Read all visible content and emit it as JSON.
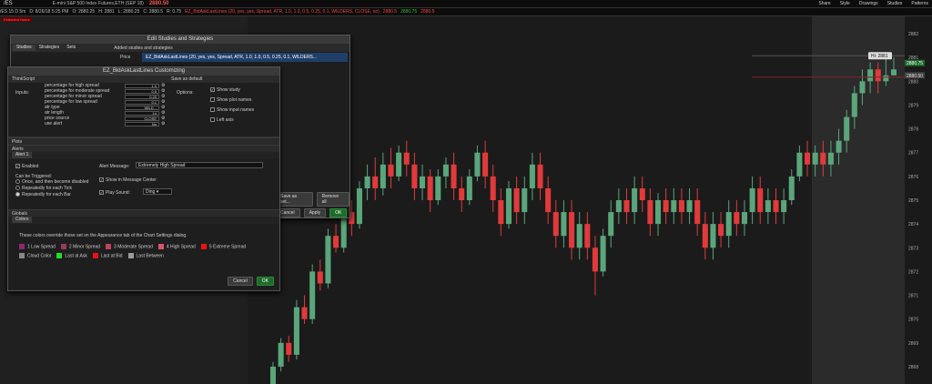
{
  "topbar": {
    "symbol": "/ES",
    "description": "E-mini S&P 500 Index Futures,ETH (SEP 18)",
    "price": "2880.50",
    "tools": [
      "Share",
      "Style",
      "Drawings",
      "Studies",
      "Patterns"
    ]
  },
  "infobar": {
    "symbol": "/ES 15 D 5m",
    "date": "D: 8/26/18 5:25 PM",
    "open": "O: 2880.25",
    "high": "H: 2881",
    "low": "L: 2880.25",
    "close": "C: 2880.5",
    "range": "R: 0.75",
    "study": "EZ_BidAskLastLines (20, yes, yes, Spread, ATR, 1.0, 1.0, 0.5, 0.25, 0.1, WILDERS, CLOSE, no)",
    "v1": "2880.5",
    "v2": "2880.75",
    "v3": "2880.5"
  },
  "badge": "Extended Hours",
  "chart_data": {
    "type": "candlestick",
    "ylim": [
      2867.5,
      2882.5
    ],
    "yticks": [
      "2882",
      "2881",
      "2880",
      "2879",
      "2878",
      "2877",
      "2876",
      "2875",
      "2874",
      "2873",
      "2872",
      "2871",
      "2870",
      "2869",
      "2868"
    ],
    "hi_label": "Hi: 2881",
    "price_labels": [
      "2880.75",
      "2880.50"
    ],
    "candles": [
      [
        2867.0,
        2868.0,
        2866.8,
        2868.2
      ],
      [
        2868.0,
        2869.0,
        2867.8,
        2869.2
      ],
      [
        2869.0,
        2868.5,
        2868.2,
        2869.3
      ],
      [
        2868.5,
        2870.5,
        2868.3,
        2870.8
      ],
      [
        2870.5,
        2870.0,
        2869.8,
        2871.0
      ],
      [
        2870.0,
        2872.0,
        2869.8,
        2872.3
      ],
      [
        2872.0,
        2871.5,
        2871.2,
        2872.5
      ],
      [
        2871.5,
        2873.5,
        2871.3,
        2873.8
      ],
      [
        2873.5,
        2873.0,
        2872.8,
        2874.0
      ],
      [
        2873.0,
        2874.5,
        2872.8,
        2874.8
      ],
      [
        2874.5,
        2874.0,
        2873.5,
        2875.0
      ],
      [
        2874.0,
        2875.5,
        2873.8,
        2875.8
      ],
      [
        2875.5,
        2876.0,
        2875.0,
        2876.5
      ],
      [
        2876.0,
        2875.5,
        2875.0,
        2876.8
      ],
      [
        2875.5,
        2876.5,
        2875.2,
        2877.0
      ],
      [
        2876.5,
        2876.0,
        2875.5,
        2877.2
      ],
      [
        2876.0,
        2877.0,
        2875.8,
        2877.3
      ],
      [
        2877.0,
        2876.5,
        2876.0,
        2877.5
      ],
      [
        2876.5,
        2875.5,
        2875.0,
        2877.0
      ],
      [
        2875.5,
        2876.0,
        2875.0,
        2876.5
      ],
      [
        2876.0,
        2875.0,
        2874.5,
        2876.3
      ],
      [
        2875.0,
        2876.0,
        2874.8,
        2876.3
      ],
      [
        2876.0,
        2876.5,
        2875.5,
        2876.8
      ],
      [
        2876.5,
        2875.5,
        2875.0,
        2877.0
      ],
      [
        2875.5,
        2875.0,
        2874.5,
        2876.0
      ],
      [
        2875.0,
        2876.0,
        2874.8,
        2876.3
      ],
      [
        2876.0,
        2877.0,
        2875.8,
        2877.3
      ],
      [
        2877.0,
        2876.0,
        2875.5,
        2877.5
      ],
      [
        2876.0,
        2875.0,
        2874.5,
        2876.5
      ],
      [
        2875.0,
        2874.0,
        2873.5,
        2875.5
      ],
      [
        2874.0,
        2875.5,
        2873.8,
        2875.8
      ],
      [
        2875.5,
        2874.5,
        2874.0,
        2876.0
      ],
      [
        2874.5,
        2875.5,
        2874.0,
        2876.0
      ],
      [
        2875.5,
        2876.5,
        2875.0,
        2877.0
      ],
      [
        2876.5,
        2875.5,
        2875.0,
        2877.0
      ],
      [
        2875.5,
        2874.5,
        2874.0,
        2876.0
      ],
      [
        2874.5,
        2873.5,
        2873.0,
        2875.0
      ],
      [
        2873.5,
        2874.5,
        2873.0,
        2875.0
      ],
      [
        2874.5,
        2873.0,
        2872.5,
        2875.0
      ],
      [
        2873.0,
        2874.0,
        2872.5,
        2874.5
      ],
      [
        2874.0,
        2873.0,
        2872.5,
        2874.5
      ],
      [
        2873.0,
        2872.0,
        2871.0,
        2873.5
      ],
      [
        2872.0,
        2873.5,
        2871.8,
        2873.8
      ],
      [
        2873.5,
        2874.5,
        2873.0,
        2875.0
      ],
      [
        2874.5,
        2875.0,
        2874.0,
        2875.5
      ],
      [
        2875.0,
        2874.5,
        2874.0,
        2875.5
      ],
      [
        2874.5,
        2875.5,
        2874.0,
        2876.0
      ],
      [
        2875.5,
        2875.0,
        2874.5,
        2876.0
      ],
      [
        2875.0,
        2874.0,
        2873.5,
        2875.5
      ],
      [
        2874.0,
        2875.0,
        2873.5,
        2875.3
      ],
      [
        2875.0,
        2874.5,
        2874.0,
        2875.5
      ],
      [
        2874.5,
        2875.0,
        2874.0,
        2875.5
      ],
      [
        2875.0,
        2874.5,
        2874.0,
        2875.5
      ],
      [
        2874.5,
        2875.0,
        2874.0,
        2875.5
      ],
      [
        2875.0,
        2874.0,
        2873.5,
        2875.5
      ],
      [
        2874.0,
        2873.0,
        2872.5,
        2874.5
      ],
      [
        2873.0,
        2874.0,
        2872.5,
        2874.5
      ],
      [
        2874.0,
        2873.5,
        2873.0,
        2874.5
      ],
      [
        2873.5,
        2874.5,
        2873.0,
        2875.0
      ],
      [
        2874.5,
        2874.0,
        2873.5,
        2875.0
      ],
      [
        2874.0,
        2874.5,
        2873.5,
        2875.0
      ],
      [
        2874.5,
        2875.5,
        2874.0,
        2876.0
      ],
      [
        2875.5,
        2874.5,
        2874.0,
        2876.0
      ],
      [
        2874.5,
        2875.0,
        2874.0,
        2875.5
      ],
      [
        2875.0,
        2874.5,
        2874.0,
        2875.5
      ],
      [
        2874.5,
        2875.0,
        2874.0,
        2875.5
      ],
      [
        2875.0,
        2876.0,
        2874.8,
        2876.3
      ],
      [
        2876.0,
        2877.0,
        2875.8,
        2877.3
      ],
      [
        2877.0,
        2876.5,
        2876.0,
        2877.5
      ],
      [
        2876.5,
        2877.0,
        2876.0,
        2877.3
      ],
      [
        2877.0,
        2876.5,
        2876.0,
        2877.5
      ],
      [
        2876.5,
        2877.0,
        2876.0,
        2877.5
      ],
      [
        2877.0,
        2877.5,
        2876.5,
        2878.0
      ],
      [
        2877.5,
        2878.5,
        2877.0,
        2878.8
      ],
      [
        2878.5,
        2879.5,
        2878.0,
        2879.8
      ],
      [
        2879.5,
        2880.0,
        2879.0,
        2880.5
      ],
      [
        2880.0,
        2880.5,
        2879.5,
        2880.8
      ],
      [
        2880.5,
        2880.0,
        2879.5,
        2880.8
      ],
      [
        2880.0,
        2880.25,
        2879.8,
        2881.0
      ],
      [
        2880.25,
        2880.5,
        2880.25,
        2881.0
      ]
    ]
  },
  "studies_dlg": {
    "title": "Edit Studies and Strategies",
    "tabs": [
      "Studies",
      "Strategies",
      "Sets"
    ],
    "added_label": "Added studies and strategies",
    "price_label": "Price",
    "study_entry": "EZ_BidAskLastLines (20, yes, yes, Spread, ATR, 1.0, 1.0, 0.5, 0.25, 0.1, WILDERS...",
    "save_as_set": "Save as set...",
    "remove_all": "Remove all",
    "cancel": "Cancel",
    "apply": "Apply",
    "ok": "OK"
  },
  "custom_dlg": {
    "title": "EZ_BidAskLastLines Customizing",
    "thinkscript": "ThinkScript",
    "save_default": "Save as default",
    "inputs_label": "Inputs:",
    "inputs": [
      {
        "name": "percentage for high spread",
        "value": "1.0"
      },
      {
        "name": "percentage for moderate spread",
        "value": "0.5"
      },
      {
        "name": "percentage for minor spread",
        "value": "0.25"
      },
      {
        "name": "percentage for low spread",
        "value": "0.1"
      },
      {
        "name": "atr type",
        "value": "WILD..."
      },
      {
        "name": "atr length",
        "value": "14"
      },
      {
        "name": "price source",
        "value": "CLOSE"
      },
      {
        "name": "use alert",
        "value": "No"
      }
    ],
    "options_label": "Options:",
    "options": [
      {
        "label": "Show study",
        "checked": true
      },
      {
        "label": "Show plot names",
        "checked": false
      },
      {
        "label": "Show input names",
        "checked": false
      },
      {
        "label": "Left axis",
        "checked": false
      }
    ],
    "plots": "Plots",
    "alerts": "Alerts",
    "alert_tab": "Alert 1",
    "enabled": "Enabled",
    "alert_msg_label": "Alert Message:",
    "alert_msg": "Extremely High Spread",
    "triggered_label": "Can be Triggered:",
    "trig_options": [
      "Once, and then become disabled",
      "Repeatedly for each Tick",
      "Repeatedly for each Bar"
    ],
    "show_msg_center": "Show in Message Center",
    "play_sound": "Play Sound:",
    "sound": "Ding",
    "globals": "Globals",
    "colors_tab": "Colors",
    "colors_note": "These colors override those set on the Appearance tab of the Chart Settings dialog.",
    "swatches": [
      {
        "label": "1 Low Spread",
        "color": "#8a2a6a"
      },
      {
        "label": "2 Minor Spread",
        "color": "#9a3a5a"
      },
      {
        "label": "3 Moderate Spread",
        "color": "#c04060"
      },
      {
        "label": "4 High Spread",
        "color": "#e05070"
      },
      {
        "label": "5 Extreme Spread",
        "color": "#ee1111"
      },
      {
        "label": "Cloud Color",
        "color": "#888888"
      },
      {
        "label": "Last at Ask",
        "color": "#22dd22"
      },
      {
        "label": "Last at Bid",
        "color": "#ee1111"
      },
      {
        "label": "Last Between",
        "color": "#999999"
      }
    ],
    "cancel": "Cancel",
    "ok": "OK"
  }
}
